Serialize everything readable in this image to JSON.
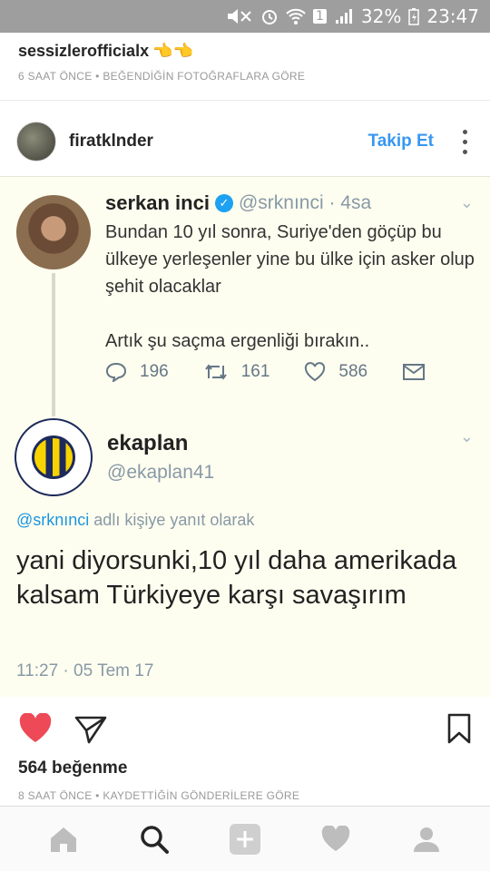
{
  "status_bar": {
    "battery": "32%",
    "time": "23:47",
    "sim_label": "1"
  },
  "previous_post": {
    "username": "sessizlerofficialx",
    "emoji": "👈👈",
    "meta": "6 SAAT ÖNCE • BEĞENDİĞİN FOTOĞRAFLARA GÖRE"
  },
  "post": {
    "username": "firatklnder",
    "follow_label": "Takip Et",
    "likes": "564 beğenme",
    "meta": "8 SAAT ÖNCE • KAYDETTİĞİN GÖNDERİLERE GÖRE"
  },
  "tweet1": {
    "name": "serkan inci",
    "verified_mark": "✓",
    "handle": "@srknınci · 4sa",
    "text_line1": "Bundan 10 yıl sonra, Suriye'den göçüp bu ülkeye yerleşenler yine bu ülke için asker olup şehit olacaklar",
    "text_line2": "Artık şu saçma ergenliği bırakın..",
    "replies": "196",
    "retweets": "161",
    "likes": "586",
    "chevron": "⌄"
  },
  "tweet2": {
    "name": "ekaplan",
    "handle": "@ekaplan41",
    "reply_mention": "@srknınci",
    "reply_suffix": " adlı kişiye yanıt olarak",
    "text": "yani diyorsunki,10 yıl daha amerikada kalsam Türkiyeye karşı savaşırım",
    "time": "11:27 · 05 Tem 17",
    "chevron": "⌄"
  },
  "colors": {
    "status_bar": "#9e9e9e",
    "follow_blue": "#3897f0",
    "like_red": "#ed4956",
    "tweet_bg": "#fefef0"
  },
  "icons": {
    "nav": [
      "home-icon",
      "search-icon",
      "add-icon",
      "activity-heart-icon",
      "profile-icon"
    ],
    "actions": [
      "like-heart-icon",
      "share-plane-icon",
      "bookmark-icon"
    ]
  }
}
